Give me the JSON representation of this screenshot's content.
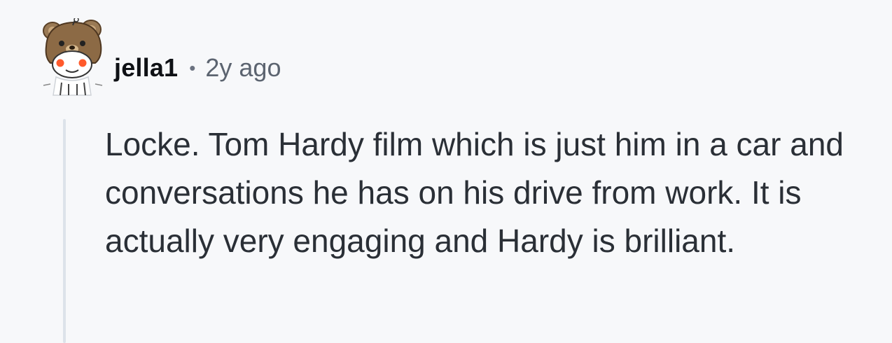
{
  "comment": {
    "author": "jella1",
    "separator": "•",
    "timestamp": "2y ago",
    "avatar_icon": "bear-snoo-avatar-icon",
    "body": "Locke. Tom Hardy film which is just him in a car and conversations he has on his drive from work. It is actually very engaging and Hardy is brilliant."
  },
  "colors": {
    "background": "#f7f8fa",
    "thread_line": "#dde3ea",
    "username": "#0f1115",
    "meta_text": "#5c6470",
    "body_text": "#2a2f36"
  }
}
